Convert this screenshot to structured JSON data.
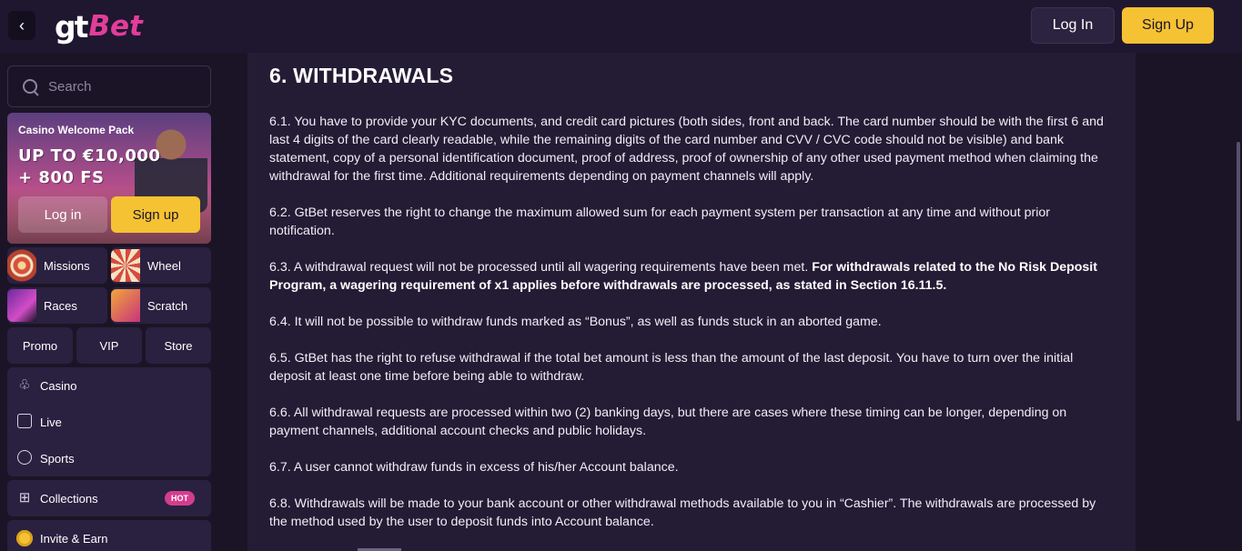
{
  "header": {
    "back_icon": "chevron-left-icon",
    "logo_gt": "gt",
    "logo_bet": "Bet",
    "login_label": "Log In",
    "signup_label": "Sign Up"
  },
  "sidebar": {
    "search_placeholder": "Search",
    "promo": {
      "title": "Casino Welcome Pack",
      "amount_line1": "UP TO €10,000",
      "amount_line2": "+ 800 FS",
      "login_label": "Log in",
      "signup_label": "Sign up"
    },
    "tiles": [
      {
        "label": "Missions"
      },
      {
        "label": "Wheel"
      },
      {
        "label": "Races"
      },
      {
        "label": "Scratch"
      }
    ],
    "pills": [
      {
        "label": "Promo"
      },
      {
        "label": "VIP"
      },
      {
        "label": "Store"
      }
    ],
    "menu": {
      "casino": "Casino",
      "live": "Live",
      "sports": "Sports",
      "collections": "Collections",
      "hot_badge": "HOT",
      "invite": "Invite & Earn"
    }
  },
  "content": {
    "heading": "6. WITHDRAWALS",
    "paragraphs": {
      "p1": "6.1. You have to provide your KYC documents, and credit card pictures (both sides, front and back. The card number should be with the first 6 and last 4 digits of the card clearly readable, while the remaining digits of the card number and CVV / CVC code should not be visible) and bank statement, copy of a personal identification document, proof of address, proof of ownership of any other used payment method when claiming the withdrawal for the first time. Additional requirements depending on payment channels will apply.",
      "p2": "6.2. GtBet reserves the right to change the maximum allowed sum for each payment system per transaction at any time and without prior notification.",
      "p3_plain": "6.3. A withdrawal request will not be processed until all wagering requirements have been met. ",
      "p3_bold": "For withdrawals related to the No Risk Deposit Program, a wagering requirement of x1 applies before withdrawals are processed, as stated in Section 16.11.5.",
      "p4": "6.4. It will not be possible to withdraw funds marked as “Bonus”, as well as funds stuck in an aborted game.",
      "p5": "6.5. GtBet has the right to refuse withdrawal if the total bet amount is less than the amount of the last deposit. You have to turn over the initial deposit at least one time before being able to withdraw.",
      "p6": "6.6. All withdrawal requests are processed within two (2) banking days, but there are cases where these timing can be longer, depending on payment channels, additional account checks and public holidays.",
      "p7": "6.7. A user cannot withdraw funds in excess of his/her Account balance.",
      "p8": "6.8. Withdrawals will be made to your bank account or other withdrawal methods available to you in “Cashier”. The withdrawals are processed by the method used by the user to deposit funds into Account balance."
    }
  },
  "colors": {
    "accent_yellow": "#f5c233",
    "brand_pink": "#e33d9a",
    "background": "#1b1426",
    "panel": "#241c35"
  }
}
